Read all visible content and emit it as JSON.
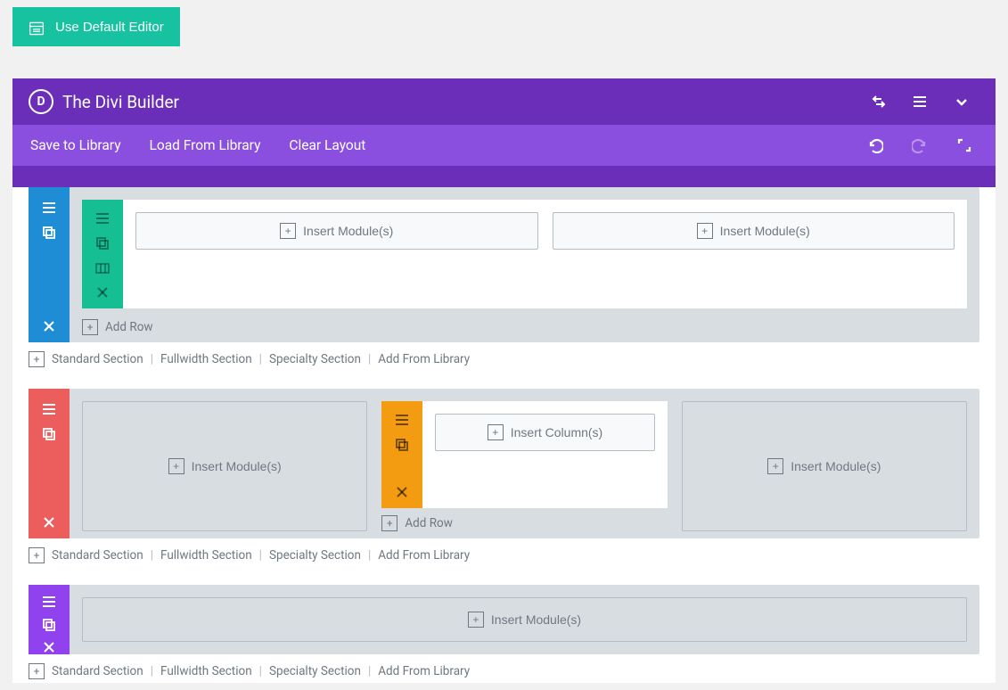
{
  "default_editor_label": "Use Default Editor",
  "header": {
    "title": "The Divi Builder",
    "logo_letter": "D"
  },
  "toolbar": {
    "save_library": "Save to Library",
    "load_library": "Load From Library",
    "clear_layout": "Clear Layout"
  },
  "labels": {
    "insert_modules": "Insert Module(s)",
    "insert_columns": "Insert Column(s)",
    "add_row": "Add Row"
  },
  "section_links": {
    "standard": "Standard Section",
    "fullwidth": "Fullwidth Section",
    "specialty": "Specialty Section",
    "from_library": "Add From Library"
  }
}
